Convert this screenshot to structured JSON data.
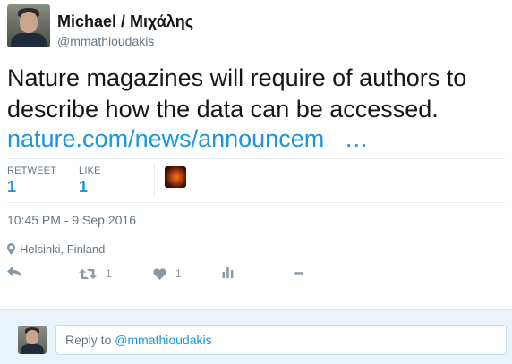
{
  "author": {
    "name": "Michael / Μιχάλης",
    "handle": "@mmathioudakis"
  },
  "tweet": {
    "text": "Nature magazines will require of authors to describe how the data can be accessed.",
    "link": "nature.com/news/announcem",
    "link_ellipsis": "…"
  },
  "stats": {
    "retweet_label": "RETWEET",
    "retweet_count": "1",
    "like_label": "LIKE",
    "like_count": "1"
  },
  "timestamp": "10:45 PM - 9 Sep 2016",
  "location": "Helsinki, Finland",
  "actions": {
    "retweet_count": "1",
    "like_count": "1",
    "more_glyph": "•••"
  },
  "reply": {
    "prefix": "Reply to ",
    "mention": "@mmathioudakis"
  },
  "colors": {
    "link": "#1b95e0",
    "muted": "#657786",
    "icon": "#8899a6",
    "reply_bg": "#e8f4fb"
  },
  "icons": [
    "location-pin-icon",
    "reply-icon",
    "retweet-icon",
    "heart-icon",
    "analytics-icon",
    "more-icon"
  ]
}
